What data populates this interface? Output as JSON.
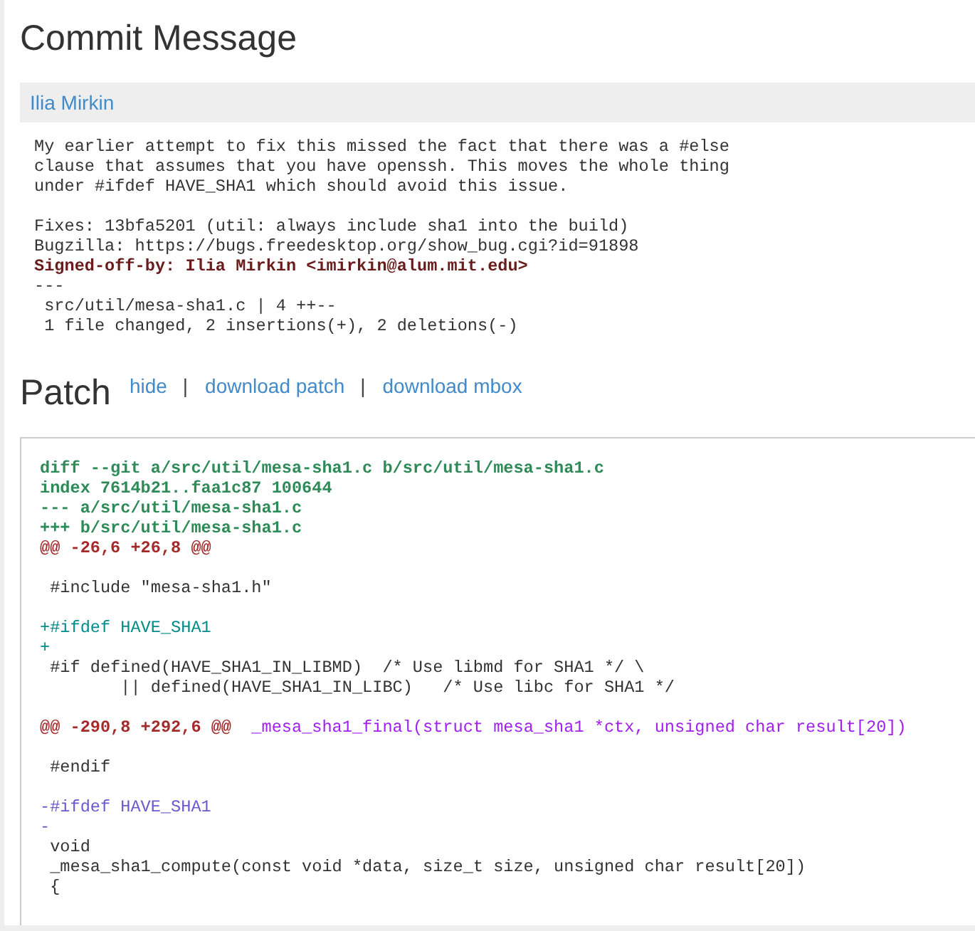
{
  "commit": {
    "title": "Commit Message",
    "author": "Ilia Mirkin",
    "message": [
      {
        "kind": "paragraph",
        "text": "My earlier attempt to fix this missed the fact that there was a #else\nclause that assumes that you have openssh. This moves the whole thing\nunder #ifdef HAVE_SHA1 which should avoid this issue."
      },
      {
        "kind": "line",
        "text": "Fixes: 13bfa5201 (util: always include sha1 into the build)"
      },
      {
        "kind": "line",
        "text": "Bugzilla: https://bugs.freedesktop.org/show_bug.cgi?id=91898"
      },
      {
        "kind": "signoff",
        "text": "Signed-off-by: Ilia Mirkin <imirkin@alum.mit.edu>"
      },
      {
        "kind": "line",
        "text": "---"
      },
      {
        "kind": "line",
        "text": " src/util/mesa-sha1.c | 4 ++--"
      },
      {
        "kind": "line",
        "text": " 1 file changed, 2 insertions(+), 2 deletions(-)"
      }
    ]
  },
  "patch": {
    "title": "Patch",
    "actions": [
      {
        "kind": "link",
        "label": "hide"
      },
      {
        "kind": "separator",
        "label": "|"
      },
      {
        "kind": "link",
        "label": "download patch"
      },
      {
        "kind": "separator",
        "label": "|"
      },
      {
        "kind": "link",
        "label": "download mbox"
      }
    ],
    "blocks": [
      {
        "lines": [
          {
            "kind": "header",
            "text": "diff --git a/src/util/mesa-sha1.c b/src/util/mesa-sha1.c"
          },
          {
            "kind": "header",
            "text": "index 7614b21..faa1c87 100644"
          },
          {
            "kind": "header",
            "text": "--- a/src/util/mesa-sha1.c"
          },
          {
            "kind": "header",
            "text": "+++ b/src/util/mesa-sha1.c"
          },
          {
            "kind": "chunk",
            "text": "@@ -26,6 +26,8 @@"
          }
        ]
      },
      {
        "lines": [
          {
            "kind": "context",
            "text": " #include \"mesa-sha1.h\""
          }
        ]
      },
      {
        "lines": [
          {
            "kind": "add",
            "text": "+#ifdef HAVE_SHA1"
          },
          {
            "kind": "add",
            "text": "+"
          },
          {
            "kind": "context",
            "text": " #if defined(HAVE_SHA1_IN_LIBMD)  /* Use libmd for SHA1 */ \\"
          },
          {
            "kind": "context",
            "text": "        || defined(HAVE_SHA1_IN_LIBC)   /* Use libc for SHA1 */"
          }
        ]
      },
      {
        "lines": [
          {
            "kind": "chunk",
            "text": "@@ -290,8 +292,6 @@",
            "context": "_mesa_sha1_final(struct mesa_sha1 *ctx, unsigned char result[20])"
          }
        ]
      },
      {
        "lines": [
          {
            "kind": "context",
            "text": " #endif"
          }
        ]
      },
      {
        "lines": [
          {
            "kind": "del",
            "text": "-#ifdef HAVE_SHA1"
          },
          {
            "kind": "del",
            "text": "-"
          },
          {
            "kind": "context",
            "text": " void"
          },
          {
            "kind": "context",
            "text": " _mesa_sha1_compute(const void *data, size_t size, unsigned char result[20])"
          },
          {
            "kind": "context",
            "text": " {"
          }
        ]
      }
    ]
  }
}
